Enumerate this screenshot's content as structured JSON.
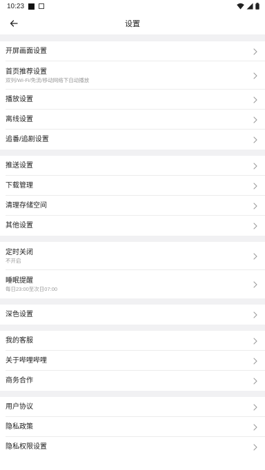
{
  "status_bar": {
    "time": "10:23",
    "icons": [
      "notification-square-icon",
      "notification-box-icon",
      "wifi-icon",
      "cellular-icon",
      "battery-icon"
    ]
  },
  "header": {
    "title": "设置",
    "back_icon": "back-arrow-icon"
  },
  "groups": [
    {
      "items": [
        {
          "label": "开屏画面设置"
        },
        {
          "label": "首页推荐设置",
          "sub": "双列/Wi-Fi/免流/移动网络下自动播放"
        },
        {
          "label": "播放设置"
        },
        {
          "label": "离线设置"
        },
        {
          "label": "追番/追剧设置"
        }
      ]
    },
    {
      "items": [
        {
          "label": "推送设置"
        },
        {
          "label": "下载管理"
        },
        {
          "label": "清理存储空间"
        },
        {
          "label": "其他设置"
        }
      ]
    },
    {
      "items": [
        {
          "label": "定时关闭",
          "sub": "不开启"
        },
        {
          "label": "睡眠提醒",
          "sub": "每日23:00至次日07:00"
        }
      ]
    },
    {
      "items": [
        {
          "label": "深色设置"
        }
      ]
    },
    {
      "items": [
        {
          "label": "我的客服"
        },
        {
          "label": "关于哔哩哔哩"
        },
        {
          "label": "商务合作"
        }
      ]
    },
    {
      "items": [
        {
          "label": "用户协议"
        },
        {
          "label": "隐私政策"
        },
        {
          "label": "隐私权限设置"
        }
      ]
    }
  ],
  "colors": {
    "background": "#ffffff",
    "separator": "#f1f1f3",
    "text": "#222222",
    "subtext": "#9a9a9a",
    "chevron": "#9a9a9a"
  }
}
